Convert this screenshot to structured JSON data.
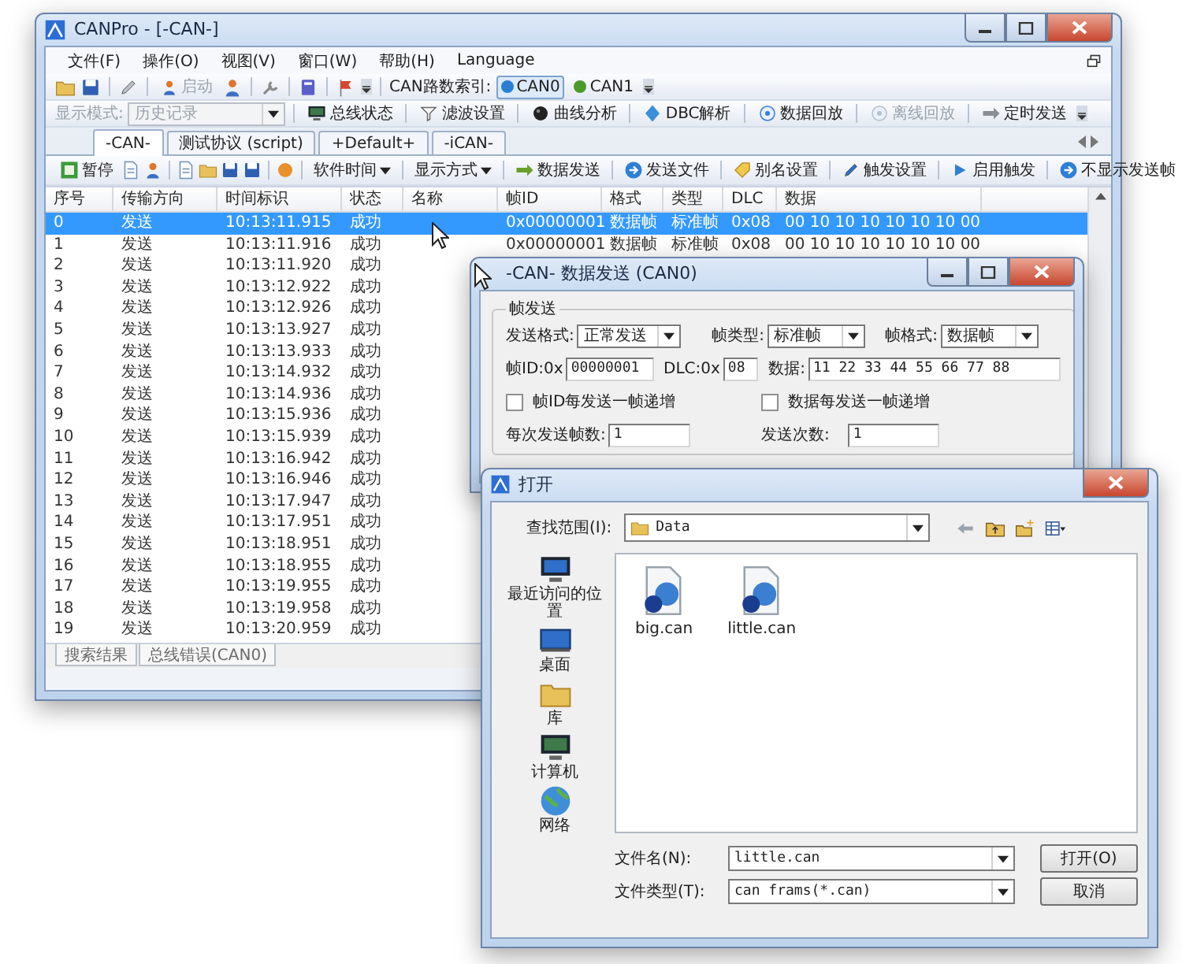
{
  "main_window": {
    "title": "CANPro - [-CAN-]",
    "menu": [
      "文件(F)",
      "操作(O)",
      "视图(V)",
      "窗口(W)",
      "帮助(H)",
      "Language"
    ],
    "toolbar1": {
      "start_button": {
        "label": "启动",
        "disabled": true
      },
      "channel_label": "CAN路数索引:",
      "channels": [
        {
          "label": "CAN0",
          "selected": true,
          "color": "#2a7fd4"
        },
        {
          "label": "CAN1",
          "selected": false,
          "color": "#4c9a2a"
        }
      ]
    },
    "toolbar2": {
      "mode_label": "显示模式:",
      "mode_value": "历史记录",
      "mode_disabled": true,
      "buttons": [
        {
          "label": "总线状态",
          "disabled": false
        },
        {
          "label": "滤波设置",
          "disabled": false
        },
        {
          "label": "曲线分析",
          "disabled": false
        },
        {
          "label": "DBC解析",
          "disabled": false
        },
        {
          "label": "数据回放",
          "disabled": false
        },
        {
          "label": "离线回放",
          "disabled": true
        },
        {
          "label": "定时发送",
          "disabled": false
        }
      ]
    },
    "tabs": [
      {
        "label": "-CAN-",
        "selected": true
      },
      {
        "label": "测试协议 (script)",
        "selected": false
      },
      {
        "label": "+Default+",
        "selected": false
      },
      {
        "label": "-iCAN-",
        "selected": false
      }
    ],
    "toolbar3": [
      {
        "kind": "button",
        "label": "暂停"
      },
      {
        "kind": "dropdown",
        "label": "软件时间"
      },
      {
        "kind": "dropdown",
        "label": "显示方式"
      },
      {
        "kind": "button",
        "label": "数据发送"
      },
      {
        "kind": "button",
        "label": "发送文件"
      },
      {
        "kind": "button",
        "label": "别名设置"
      },
      {
        "kind": "button",
        "label": "触发设置"
      },
      {
        "kind": "button",
        "label": "启用触发"
      },
      {
        "kind": "button",
        "label": "不显示发送帧"
      }
    ],
    "table": {
      "columns": [
        "序号",
        "传输方向",
        "时间标识",
        "状态",
        "名称",
        "帧ID",
        "格式",
        "类型",
        "DLC",
        "数据"
      ],
      "rows": [
        {
          "selected": true,
          "no": "0",
          "direction": "发送",
          "time": "10:13:11.915",
          "status": "成功",
          "frame_id": "0x00000001",
          "format": "数据帧",
          "type": "标准帧",
          "dlc": "0x08",
          "data": "00 10 10 10 10 10 10 00"
        },
        {
          "selected": false,
          "no": "1",
          "direction": "发送",
          "time": "10:13:11.916",
          "status": "成功",
          "frame_id": "0x00000001",
          "format": "数据帧",
          "type": "标准帧",
          "dlc": "0x08",
          "data": "00 10 10 10 10 10 10 00"
        },
        {
          "selected": false,
          "no": "2",
          "direction": "发送",
          "time": "10:13:11.920",
          "status": "成功"
        },
        {
          "selected": false,
          "no": "3",
          "direction": "发送",
          "time": "10:13:12.922",
          "status": "成功"
        },
        {
          "selected": false,
          "no": "4",
          "direction": "发送",
          "time": "10:13:12.926",
          "status": "成功"
        },
        {
          "selected": false,
          "no": "5",
          "direction": "发送",
          "time": "10:13:13.927",
          "status": "成功"
        },
        {
          "selected": false,
          "no": "6",
          "direction": "发送",
          "time": "10:13:13.933",
          "status": "成功"
        },
        {
          "selected": false,
          "no": "7",
          "direction": "发送",
          "time": "10:13:14.932",
          "status": "成功"
        },
        {
          "selected": false,
          "no": "8",
          "direction": "发送",
          "time": "10:13:14.936",
          "status": "成功"
        },
        {
          "selected": false,
          "no": "9",
          "direction": "发送",
          "time": "10:13:15.936",
          "status": "成功"
        },
        {
          "selected": false,
          "no": "10",
          "direction": "发送",
          "time": "10:13:15.939",
          "status": "成功"
        },
        {
          "selected": false,
          "no": "11",
          "direction": "发送",
          "time": "10:13:16.942",
          "status": "成功"
        },
        {
          "selected": false,
          "no": "12",
          "direction": "发送",
          "time": "10:13:16.946",
          "status": "成功"
        },
        {
          "selected": false,
          "no": "13",
          "direction": "发送",
          "time": "10:13:17.947",
          "status": "成功"
        },
        {
          "selected": false,
          "no": "14",
          "direction": "发送",
          "time": "10:13:17.951",
          "status": "成功"
        },
        {
          "selected": false,
          "no": "15",
          "direction": "发送",
          "time": "10:13:18.951",
          "status": "成功"
        },
        {
          "selected": false,
          "no": "16",
          "direction": "发送",
          "time": "10:13:18.955",
          "status": "成功"
        },
        {
          "selected": false,
          "no": "17",
          "direction": "发送",
          "time": "10:13:19.955",
          "status": "成功"
        },
        {
          "selected": false,
          "no": "18",
          "direction": "发送",
          "time": "10:13:19.958",
          "status": "成功"
        },
        {
          "selected": false,
          "no": "19",
          "direction": "发送",
          "time": "10:13:20.959",
          "status": "成功"
        }
      ]
    },
    "bottom_tabs": [
      "搜索结果",
      "总线错误(CAN0)"
    ]
  },
  "send_dialog": {
    "title": "-CAN- 数据发送 (CAN0)",
    "group_title": "帧发送",
    "selects": [
      {
        "label": "发送格式:",
        "value": "正常发送"
      },
      {
        "label": "帧类型:",
        "value": "标准帧"
      },
      {
        "label": "帧格式:",
        "value": "数据帧"
      }
    ],
    "id_label": "帧ID:0x",
    "id_value": "00000001",
    "dlc_label": "DLC:0x",
    "dlc_value": "08",
    "data_label": "数据:",
    "data_value": "11 22 33 44 55 66 77 88",
    "checkboxes": [
      {
        "label": "帧ID每发送一帧递增",
        "checked": false
      },
      {
        "label": "数据每发送一帧递增",
        "checked": false
      }
    ],
    "count_fields": [
      {
        "label": "每次发送帧数:",
        "value": "1"
      },
      {
        "label": "发送次数:",
        "value": "1"
      }
    ]
  },
  "open_dialog": {
    "title": "打开",
    "look_in_label": "查找范围(I):",
    "look_in_value": "Data",
    "places": [
      {
        "label": "最近访问的位置",
        "kind": "recent"
      },
      {
        "label": "桌面",
        "kind": "desktop"
      },
      {
        "label": "库",
        "kind": "library"
      },
      {
        "label": "计算机",
        "kind": "computer"
      },
      {
        "label": "网络",
        "kind": "network"
      }
    ],
    "files": [
      "big.can",
      "little.can"
    ],
    "filename_label": "文件名(N):",
    "filename_value": "little.can",
    "filetype_label": "文件类型(T):",
    "filetype_value": "can frams(*.can)",
    "buttons": [
      "打开(O)",
      "取消"
    ]
  }
}
